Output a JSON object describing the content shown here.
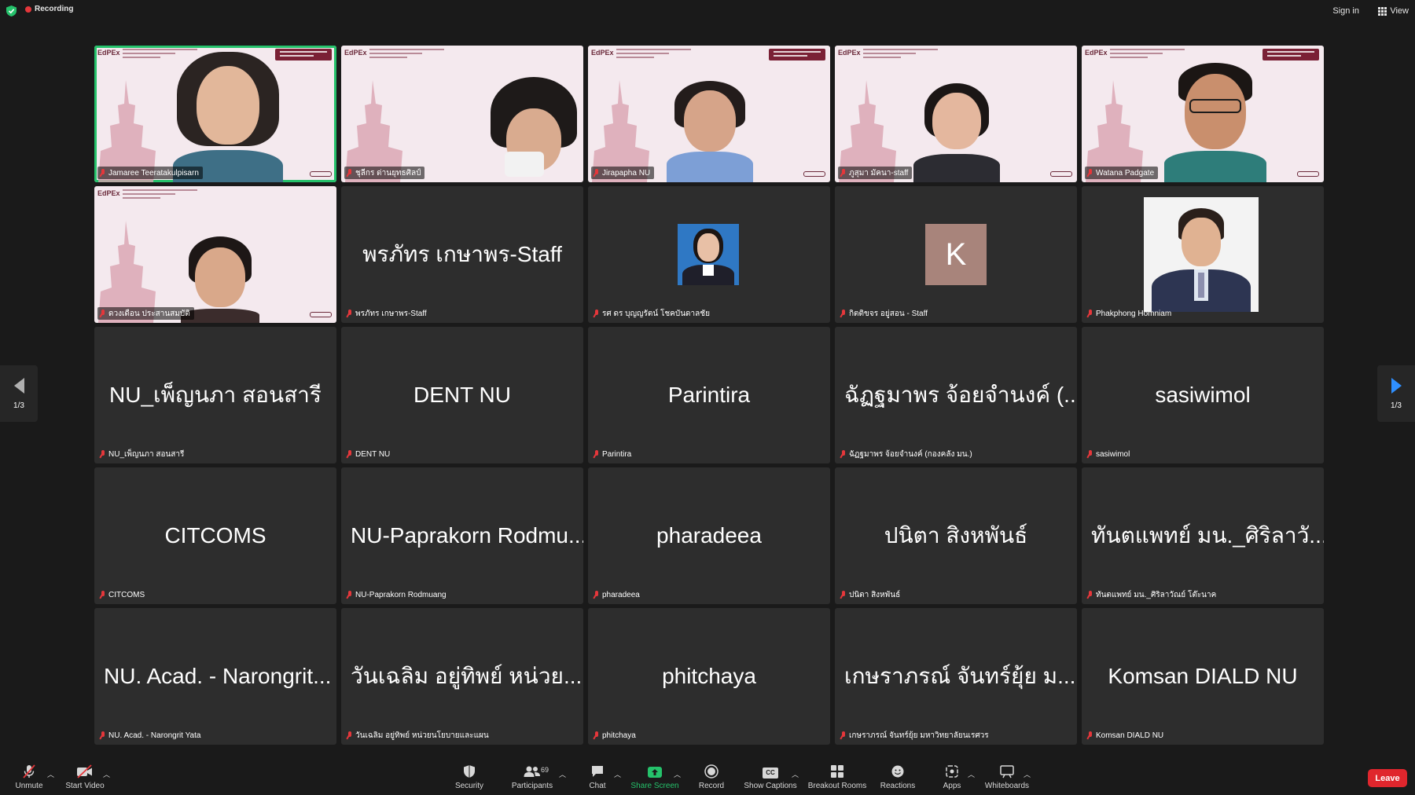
{
  "status": {
    "recording_label": "Recording",
    "sign_in_label": "Sign in",
    "view_label": "View"
  },
  "pager": {
    "left_label": "1/3",
    "right_label": "1/3"
  },
  "tiles": [
    {
      "name": "Jamaree Teeratakulpisarn",
      "kind": "video",
      "active": true
    },
    {
      "name": "ชุลีกร ด่านยุทธศิลป์",
      "kind": "video"
    },
    {
      "name": "Jirapapha NU",
      "kind": "video"
    },
    {
      "name": "ภูสุมา มัคนา-staff",
      "kind": "video"
    },
    {
      "name": "Watana Padgate",
      "kind": "video"
    },
    {
      "name": "ดวงเดือน ประสานสมบัติ",
      "kind": "video"
    },
    {
      "name": "พรภัทร เกษาพร-Staff",
      "big": "พรภัทร เกษาพร-Staff",
      "kind": "text"
    },
    {
      "name": "รศ ดร บุญญรัตน์ โชคบันดาลชัย",
      "kind": "photo"
    },
    {
      "name": "กิตติขจร อยู่สอน - Staff",
      "kind": "avatar",
      "initial": "K"
    },
    {
      "name": "Phakphong Homniam",
      "kind": "photo"
    },
    {
      "name": "NU_เพ็ญนภา สอนสารี",
      "big": "NU_เพ็ญนภา สอนสารี",
      "kind": "text"
    },
    {
      "name": "DENT NU",
      "big": "DENT NU",
      "kind": "text"
    },
    {
      "name": "Parintira",
      "big": "Parintira",
      "kind": "text"
    },
    {
      "name": "ฉัฏฐมาพร จ้อยจำนงค์ (กองคลัง มน.)",
      "big": "ฉัฏฐมาพร จ้อยจำนงค์ (...",
      "kind": "text"
    },
    {
      "name": "sasiwimol",
      "big": "sasiwimol",
      "kind": "text"
    },
    {
      "name": "CITCOMS",
      "big": "CITCOMS",
      "kind": "text"
    },
    {
      "name": "NU-Paprakorn Rodmuang",
      "big": "NU-Paprakorn Rodmu...",
      "kind": "text"
    },
    {
      "name": "pharadeea",
      "big": "pharadeea",
      "kind": "text"
    },
    {
      "name": "ปนิตา สิงหพันธ์",
      "big": "ปนิตา สิงหพันธ์",
      "kind": "text"
    },
    {
      "name": "ทันตแพทย์ มน._ศิริลาวัณย์ โต๊ะนาค",
      "big": "ทันตแพทย์ มน._ศิริลาวั...",
      "kind": "text"
    },
    {
      "name": "NU. Acad. - Narongrit  Yata",
      "big": "NU. Acad. - Narongrit...",
      "kind": "text"
    },
    {
      "name": "วันเฉลิม อยู่ทิพย์ หน่วยนโยบายและแผน",
      "big": "วันเฉลิม อยู่ทิพย์ หน่วย...",
      "kind": "text"
    },
    {
      "name": "phitchaya",
      "big": "phitchaya",
      "kind": "text"
    },
    {
      "name": "เกษราภรณ์ จันทร์ยุ้ย มหาวิทยาลัยนเรศวร",
      "big": "เกษราภรณ์ จันทร์ยุ้ย ม...",
      "kind": "text"
    },
    {
      "name": "Komsan DIALD NU",
      "big": "Komsan DIALD NU",
      "kind": "text"
    }
  ],
  "video_overlay": {
    "brand": "EdPEx"
  },
  "toolbar": {
    "unmute": "Unmute",
    "start_video": "Start Video",
    "security": "Security",
    "participants": "Participants",
    "participant_count": "69",
    "chat": "Chat",
    "share_screen": "Share Screen",
    "record": "Record",
    "show_captions": "Show Captions",
    "captions_badge": "CC",
    "breakout_rooms": "Breakout Rooms",
    "reactions": "Reactions",
    "apps": "Apps",
    "whiteboards": "Whiteboards",
    "leave": "Leave"
  },
  "colors": {
    "active_speaker": "#25c26b",
    "leave": "#e0262d",
    "muted": "#e5373b",
    "share": "#25c26b"
  }
}
